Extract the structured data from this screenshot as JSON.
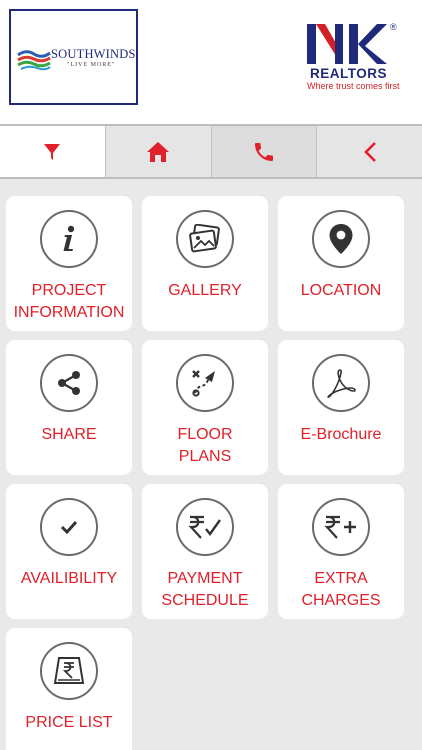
{
  "header": {
    "left_brand": "SOUTHWINDS",
    "left_tagline": "\"LIVE MORE\"",
    "right_brand": "REALTORS",
    "right_tagline": "Where trust comes first",
    "right_reg": "®"
  },
  "nav": [
    {
      "name": "filter",
      "icon": "filter-icon"
    },
    {
      "name": "home",
      "icon": "home-icon"
    },
    {
      "name": "call",
      "icon": "phone-icon"
    },
    {
      "name": "back",
      "icon": "chevron-left-icon"
    }
  ],
  "tiles": [
    {
      "label": "PROJECT\nINFORMATION",
      "icon": "info-icon"
    },
    {
      "label": "GALLERY",
      "icon": "gallery-icon"
    },
    {
      "label": "LOCATION",
      "icon": "location-pin-icon"
    },
    {
      "label": "SHARE",
      "icon": "share-icon"
    },
    {
      "label": "FLOOR\nPLANS",
      "icon": "floor-plan-icon"
    },
    {
      "label": "E-Brochure",
      "icon": "pdf-icon"
    },
    {
      "label": "AVAILIBILITY",
      "icon": "check-icon"
    },
    {
      "label": "PAYMENT\nSCHEDULE",
      "icon": "rupee-check-icon"
    },
    {
      "label": "EXTRA\nCHARGES",
      "icon": "rupee-plus-icon"
    },
    {
      "label": "PRICE LIST",
      "icon": "price-list-icon"
    }
  ],
  "colors": {
    "accent": "#e0202a",
    "brand_navy": "#1f2a7a",
    "background": "#e9e9e9"
  }
}
